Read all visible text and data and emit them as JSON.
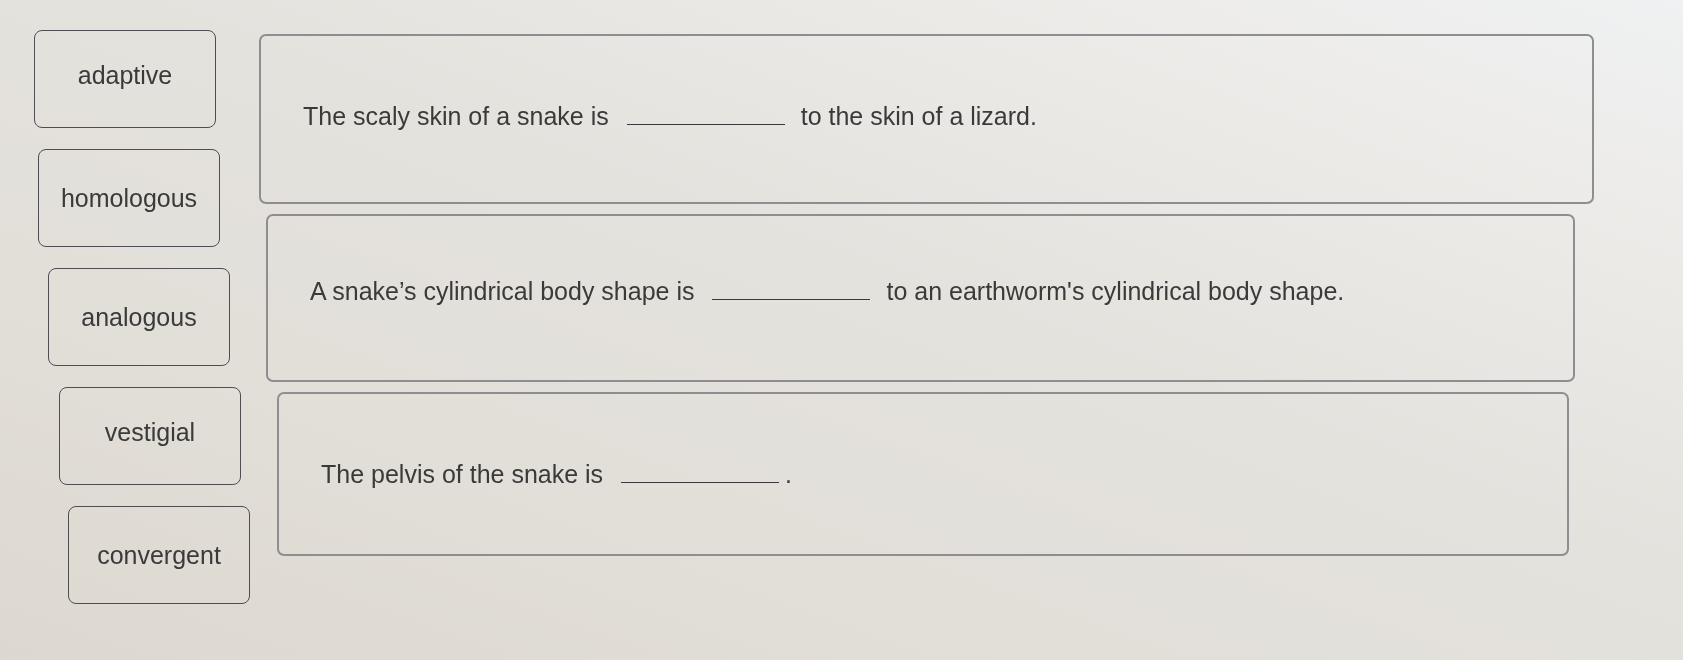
{
  "word_bank": [
    "adaptive",
    "homologous",
    "analogous",
    "vestigial",
    "convergent"
  ],
  "statements": [
    {
      "text_before": "The scaly skin of a snake is",
      "text_after": "to the skin of a lizard."
    },
    {
      "text_before": "A snake’s cylindrical body shape is",
      "text_after": "to an earthworm's cylindrical body shape."
    },
    {
      "text_before": "The pelvis of the snake is",
      "text_after": "."
    }
  ]
}
